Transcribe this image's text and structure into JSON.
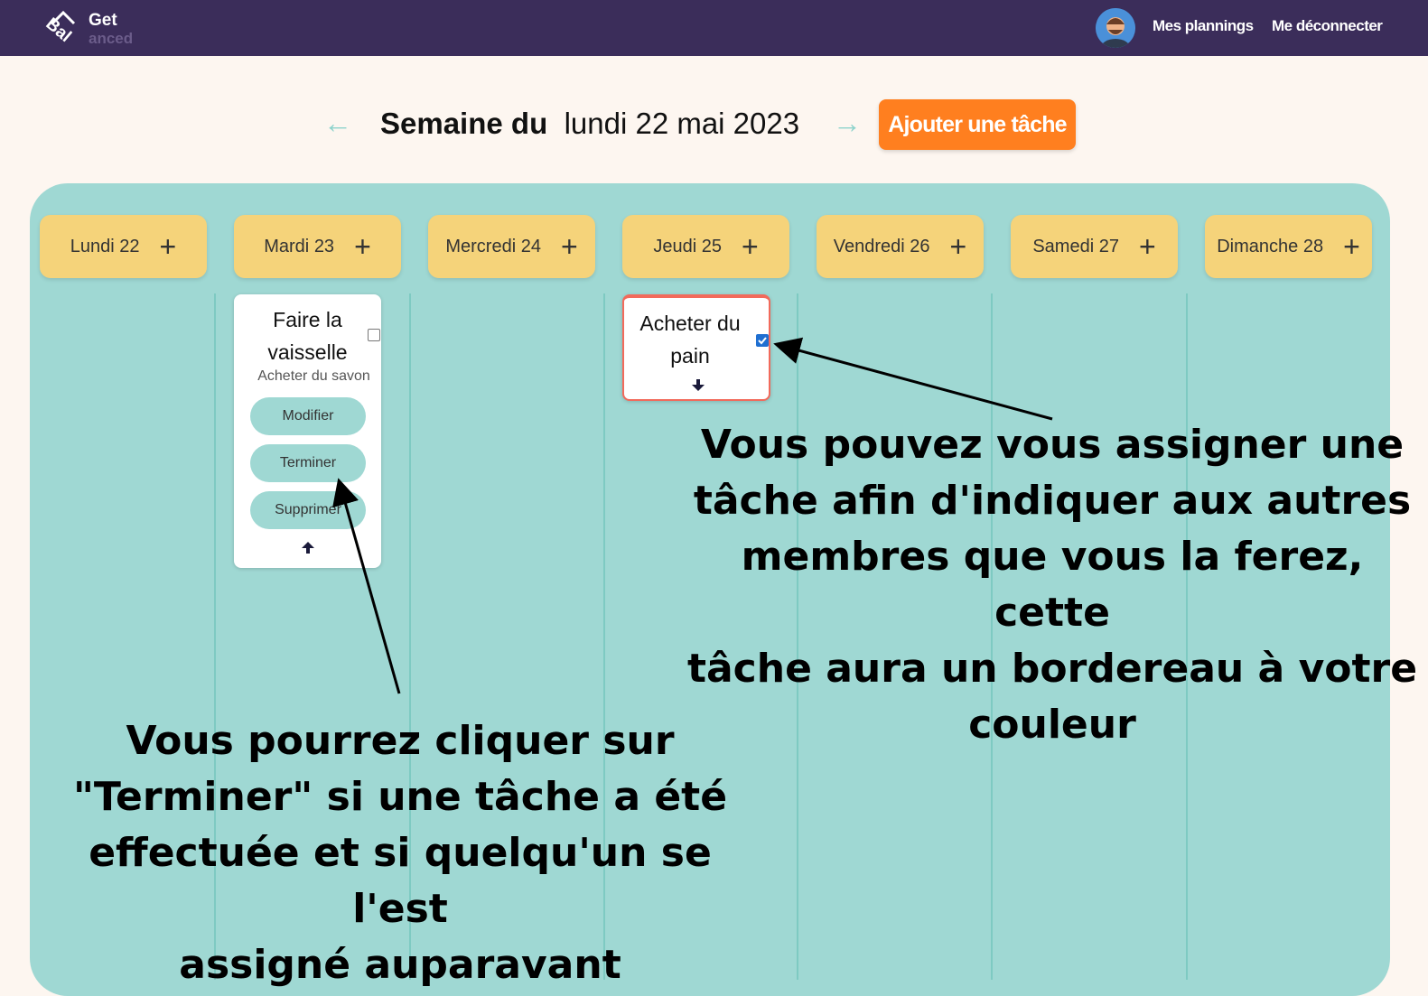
{
  "nav": {
    "logo_get": "Get",
    "logo_bal": "Bal",
    "logo_anced": "anced",
    "my_plannings": "Mes plannings",
    "logout": "Me déconnecter"
  },
  "week": {
    "prefix": "Semaine du",
    "date": "lundi 22 mai 2023",
    "prev_arrow": "←",
    "next_arrow": "→",
    "add_task": "Ajouter une tâche"
  },
  "days": [
    {
      "name": "Lundi",
      "num": "22"
    },
    {
      "name": "Mardi",
      "num": "23"
    },
    {
      "name": "Mercredi",
      "num": "24"
    },
    {
      "name": "Jeudi",
      "num": "25"
    },
    {
      "name": "Vendredi",
      "num": "26"
    },
    {
      "name": "Samedi",
      "num": "27"
    },
    {
      "name": "Dimanche",
      "num": "28"
    }
  ],
  "plus": "+",
  "task1": {
    "title_line1": "Faire la",
    "title_line2": "vaisselle",
    "subtitle": "Acheter du savon",
    "btn_edit": "Modifier",
    "btn_finish": "Terminer",
    "btn_delete": "Supprimer",
    "assigned": false
  },
  "task2": {
    "title_line1": "Acheter du",
    "title_line2": "pain",
    "assigned": true
  },
  "annotations": {
    "right": [
      "Vous pouvez vous assigner une",
      "tâche afin d'indiquer aux autres",
      "membres que vous la ferez, cette",
      "tâche aura un bordereau à votre",
      "couleur"
    ],
    "left": [
      "Vous pourrez cliquer sur",
      "\"Terminer\" si une tâche a été",
      "effectuée et si quelqu'un se l'est",
      "assigné auparavant"
    ]
  },
  "colors": {
    "navbar": "#3b2d5a",
    "accent_orange": "#ff7f1f",
    "board": "#9fd8d3",
    "day_header": "#f5d37a",
    "assigned_border": "#f26a5b"
  }
}
